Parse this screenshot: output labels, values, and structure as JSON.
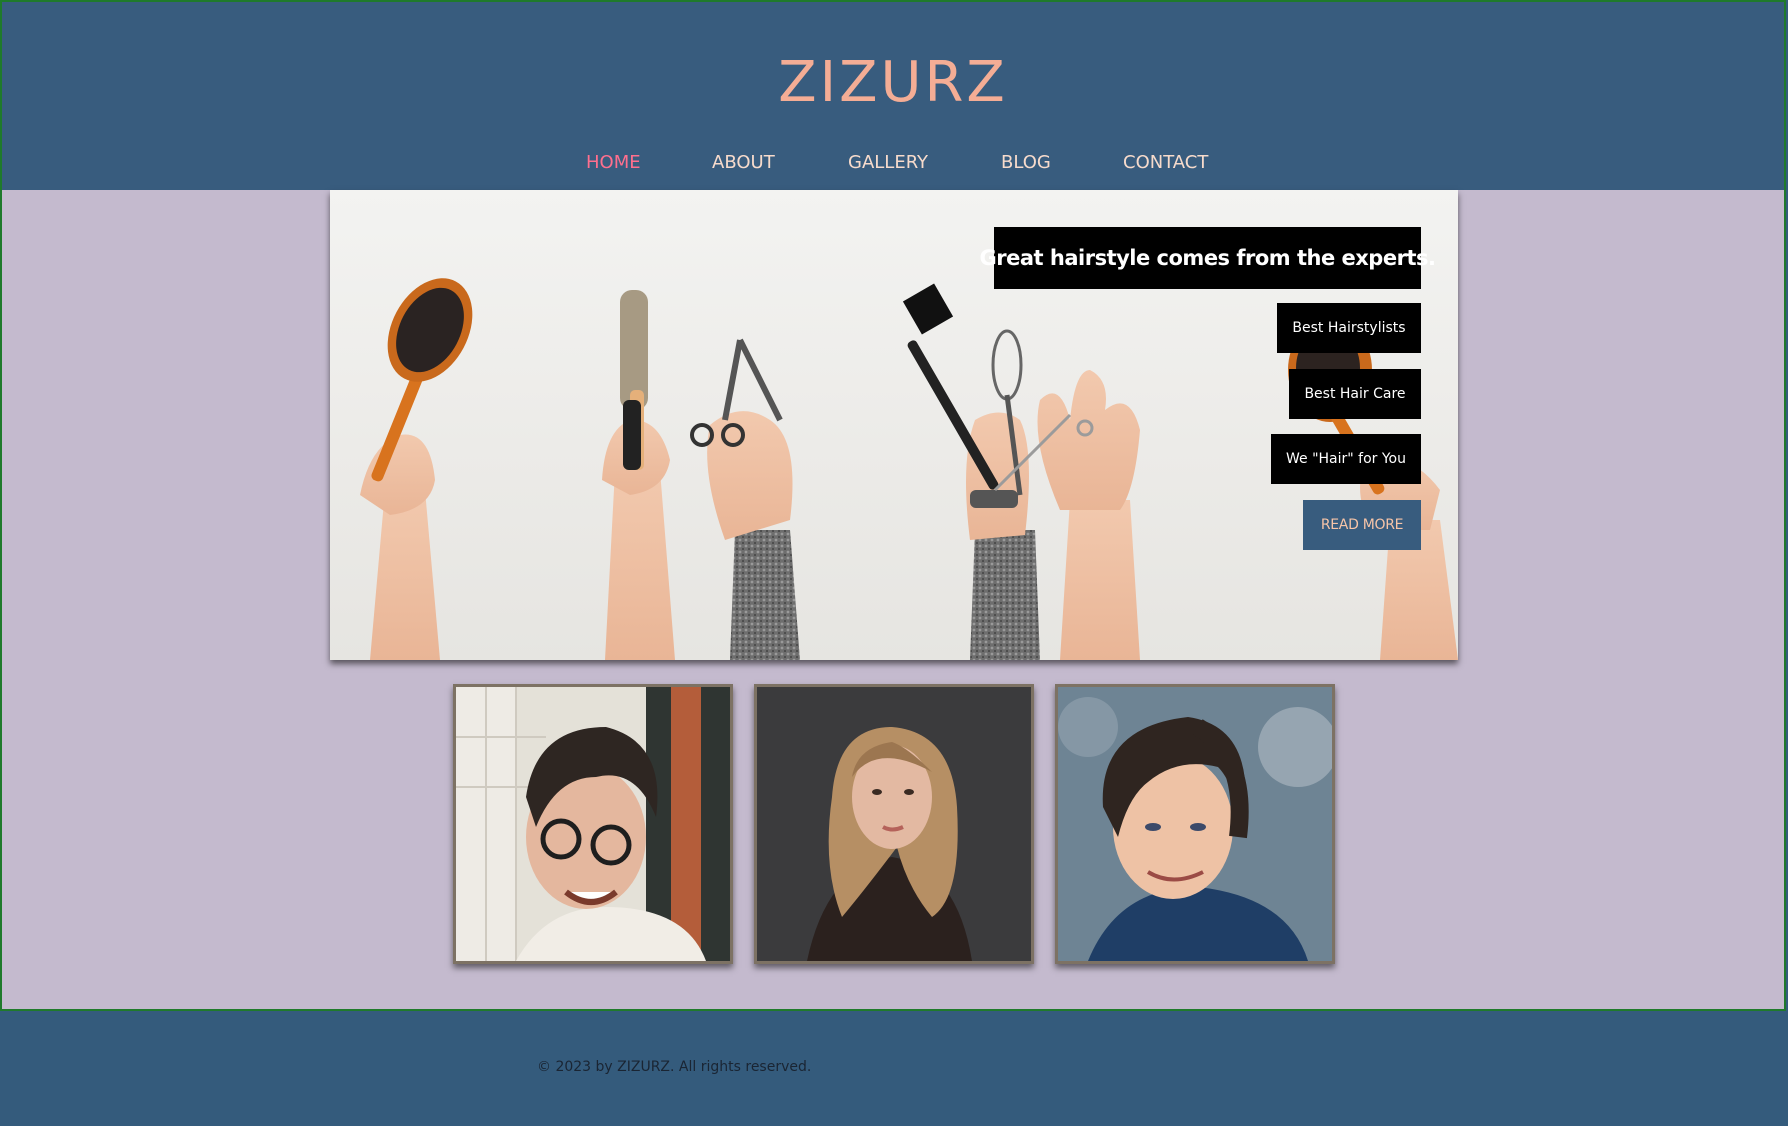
{
  "brand": {
    "logo_text": "ZIZURZ",
    "header_color": "#385c7e",
    "logo_color": "#f4ad95",
    "accent_nav_color": "#ff6f8e"
  },
  "nav": {
    "items": [
      {
        "label": "HOME",
        "active": true
      },
      {
        "label": "ABOUT",
        "active": false
      },
      {
        "label": "GALLERY",
        "active": false
      },
      {
        "label": "BLOG",
        "active": false
      },
      {
        "label": "CONTACT",
        "active": false
      }
    ]
  },
  "hero": {
    "headline": "Great hairstyle comes from the experts.",
    "tags": [
      "Best Hairstylists",
      "Best Hair Care",
      "We \"Hair\" for You"
    ],
    "cta_label": "READ MORE"
  },
  "gallery": {
    "photos": [
      {
        "name": "smiling-man-with-glasses-photo"
      },
      {
        "name": "woman-with-wavy-hair-photo"
      },
      {
        "name": "young-man-smiling-photo"
      }
    ]
  },
  "footer": {
    "copyright": "© 2023 by ZIZURZ. All rights reserved."
  }
}
